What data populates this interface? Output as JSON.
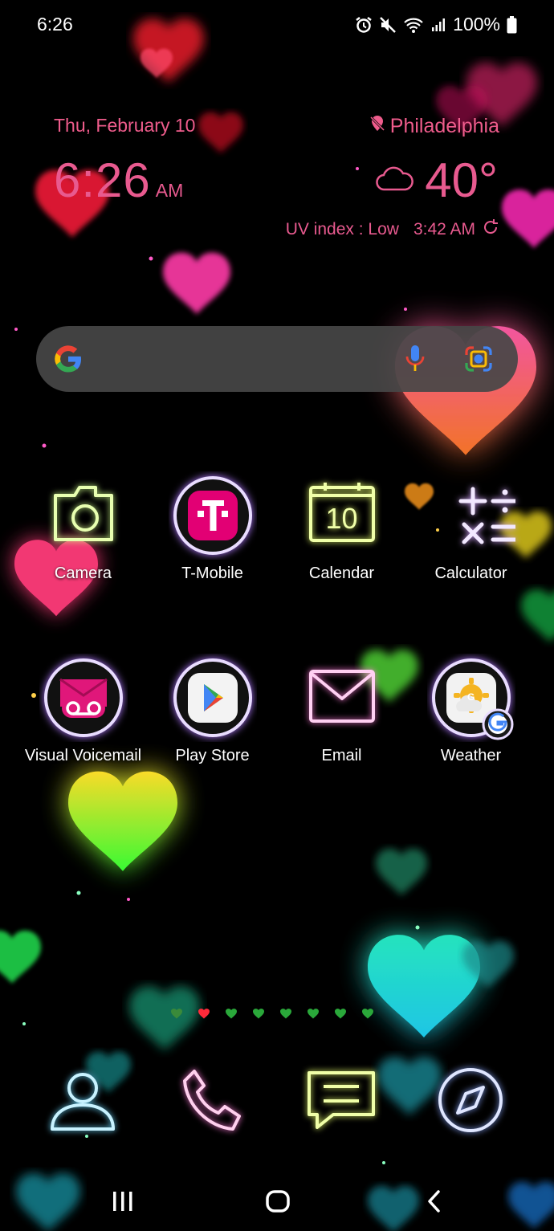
{
  "status_bar": {
    "time": "6:26",
    "battery": "100%",
    "icons": [
      "alarm-icon",
      "mute-icon",
      "wifi-icon",
      "signal-icon",
      "battery-icon"
    ]
  },
  "widget": {
    "date": "Thu, February 10",
    "time": "6:26",
    "ampm": "AM",
    "city": "Philadelphia",
    "temperature": "40°",
    "uv": "UV index : Low",
    "updated": "3:42 AM"
  },
  "search": {
    "icons": [
      "google-icon",
      "mic-icon",
      "lens-icon"
    ]
  },
  "apps_row1": [
    {
      "label": "Camera",
      "icon": "camera-icon"
    },
    {
      "label": "T-Mobile",
      "icon": "t-mobile-icon"
    },
    {
      "label": "Calendar",
      "icon": "calendar-icon",
      "day": "10"
    },
    {
      "label": "Calculator",
      "icon": "calculator-icon"
    }
  ],
  "apps_row2": [
    {
      "label": "Visual Voicemail",
      "icon": "voicemail-icon"
    },
    {
      "label": "Play Store",
      "icon": "play-store-icon"
    },
    {
      "label": "Email",
      "icon": "email-icon"
    },
    {
      "label": "Weather",
      "icon": "weather-icon"
    }
  ],
  "dock": [
    "contacts-icon",
    "phone-icon",
    "messages-icon",
    "internet-icon"
  ],
  "page_indicator": {
    "pages": 8,
    "current_index": 1
  },
  "nav": [
    "recents-icon",
    "home-icon",
    "back-icon"
  ],
  "colors": {
    "accent": "#ec5c8c",
    "widget_text": "#e85a8f"
  }
}
